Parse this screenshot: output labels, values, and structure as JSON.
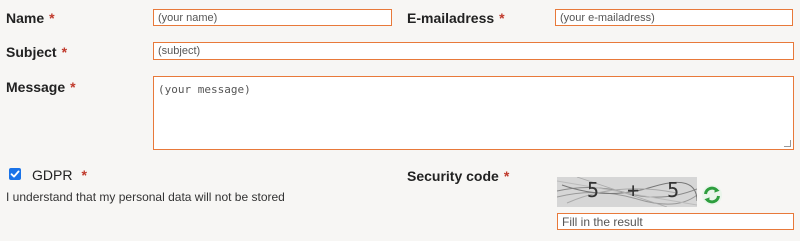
{
  "form": {
    "name": {
      "label": "Name",
      "required": "*",
      "placeholder": "(your name)"
    },
    "email": {
      "label": "E-mailadress",
      "required": "*",
      "placeholder": "(your e-mailadress)"
    },
    "subject": {
      "label": "Subject",
      "required": "*",
      "placeholder": "(subject)"
    },
    "message": {
      "label": "Message",
      "required": "*",
      "placeholder": "(your message)"
    },
    "gdpr": {
      "label": "GDPR",
      "required": "*",
      "checked": true,
      "note": "I understand that my personal data will not be stored"
    },
    "security": {
      "label": "Security code",
      "required": "*",
      "captcha_text": "5 + 5",
      "placeholder": "Fill in the result",
      "refresh_icon": "refresh-icon"
    }
  },
  "colors": {
    "field_border": "#e8793a",
    "required": "#c0392b",
    "checkbox": "#1a73e8",
    "refresh": "#2e9e3e"
  }
}
